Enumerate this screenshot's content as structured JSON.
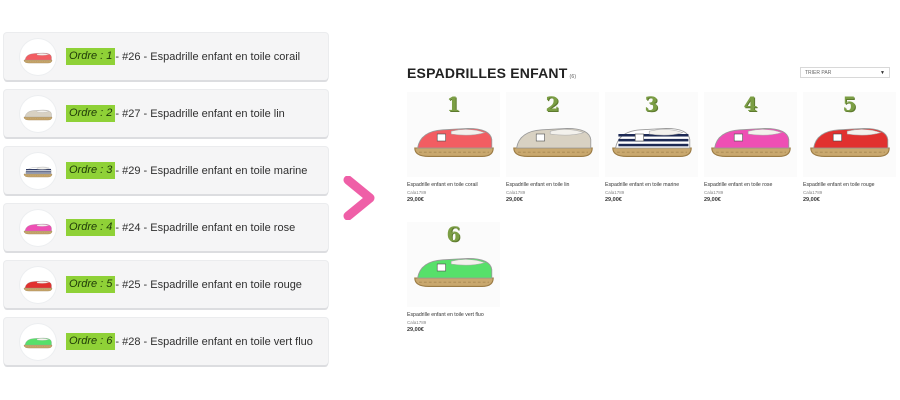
{
  "colors": {
    "order_badge_bg": "#8fd137",
    "arrow": "#ef5fa7",
    "rank_numbers": "#7b9e44"
  },
  "order_list": [
    {
      "label": "Ordre :",
      "num": "1",
      "text": " - #26 - Espadrille enfant en toile corail",
      "shoe_color": "#f25d62",
      "stripes": false
    },
    {
      "label": "Ordre :",
      "num": "2",
      "text": " - #27 - Espadrille enfant en toile lin",
      "shoe_color": "#d8d1c2",
      "stripes": false
    },
    {
      "label": "Ordre :",
      "num": "3",
      "text": " - #29 - Espadrille enfant en toile marine",
      "shoe_color": "#ffffff",
      "stripes": true
    },
    {
      "label": "Ordre :",
      "num": "4",
      "text": " - #24 - Espadrille enfant en toile rose",
      "shoe_color": "#ee4fb4",
      "stripes": false
    },
    {
      "label": "Ordre :",
      "num": "5",
      "text": " - #25 - Espadrille enfant en toile rouge",
      "shoe_color": "#e1312f",
      "stripes": false
    },
    {
      "label": "Ordre :",
      "num": "6",
      "text": " - #28 - Espadrille enfant en toile vert fluo",
      "shoe_color": "#57e06a",
      "stripes": false
    }
  ],
  "arrow_icon": "chevron-right-icon",
  "store": {
    "title": "ESPADRILLES ENFANT",
    "count": "(6)",
    "sort_label": "TRIER PAR",
    "products": [
      {
        "rank": "1",
        "name": "Espadrille enfant en toile corail",
        "ref": "Cala1789",
        "price": "29,00€",
        "shoe_color": "#f25d62",
        "stripes": false
      },
      {
        "rank": "2",
        "name": "Espadrille enfant en toile lin",
        "ref": "Cala1789",
        "price": "29,00€",
        "shoe_color": "#d8d1c2",
        "stripes": false
      },
      {
        "rank": "3",
        "name": "Espadrille enfant en toile marine",
        "ref": "Cala1789",
        "price": "29,00€",
        "shoe_color": "#ffffff",
        "stripes": true
      },
      {
        "rank": "4",
        "name": "Espadrille enfant en toile rose",
        "ref": "Cala1789",
        "price": "29,00€",
        "shoe_color": "#ee4fb4",
        "stripes": false
      },
      {
        "rank": "5",
        "name": "Espadrille enfant en toile rouge",
        "ref": "Cala1789",
        "price": "29,00€",
        "shoe_color": "#e1312f",
        "stripes": false
      },
      {
        "rank": "6",
        "name": "Espadrille enfant en toile vert fluo",
        "ref": "Cala1789",
        "price": "29,00€",
        "shoe_color": "#57e06a",
        "stripes": false
      }
    ]
  }
}
